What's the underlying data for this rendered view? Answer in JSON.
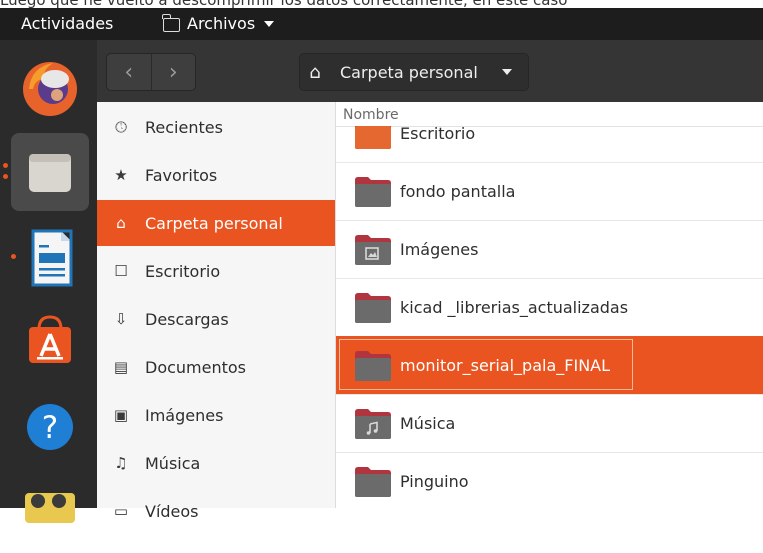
{
  "top_text": "Luego que he vuelto a descomprimir los datos correctamente, en este caso",
  "topbar": {
    "activities": "Actividades",
    "app_menu": "Archivos"
  },
  "dock": {
    "items": [
      {
        "name": "firefox-icon",
        "active": false
      },
      {
        "name": "files-icon",
        "active": true
      },
      {
        "name": "libreoffice-writer-icon",
        "active": false
      },
      {
        "name": "software-center-icon",
        "active": false
      },
      {
        "name": "help-icon",
        "active": false
      },
      {
        "name": "other-app-icon",
        "active": false
      }
    ]
  },
  "header": {
    "back_label": "‹",
    "forward_label": "›",
    "path_label": "Carpeta personal"
  },
  "sidebar": {
    "items": [
      {
        "label": "Recientes",
        "icon": "clock-icon"
      },
      {
        "label": "Favoritos",
        "icon": "star-icon"
      },
      {
        "label": "Carpeta personal",
        "icon": "home-icon",
        "active": true
      },
      {
        "label": "Escritorio",
        "icon": "desktop-icon"
      },
      {
        "label": "Descargas",
        "icon": "download-icon"
      },
      {
        "label": "Documentos",
        "icon": "document-icon"
      },
      {
        "label": "Imágenes",
        "icon": "image-icon"
      },
      {
        "label": "Música",
        "icon": "music-icon"
      },
      {
        "label": "Vídeos",
        "icon": "video-icon"
      }
    ]
  },
  "list": {
    "column_name": "Nombre",
    "rows": [
      {
        "name": "Escritorio"
      },
      {
        "name": "fondo pantalla"
      },
      {
        "name": "Imágenes"
      },
      {
        "name": "kicad _librerias_actualizadas"
      },
      {
        "name": "monitor_serial_pala_FINAL",
        "selected": true
      },
      {
        "name": "Música"
      },
      {
        "name": "Pinguino"
      }
    ]
  },
  "colors": {
    "accent": "#e95420",
    "topbar": "#1d1d1d",
    "dock": "#2b2b2b",
    "headerbar": "#353535"
  }
}
